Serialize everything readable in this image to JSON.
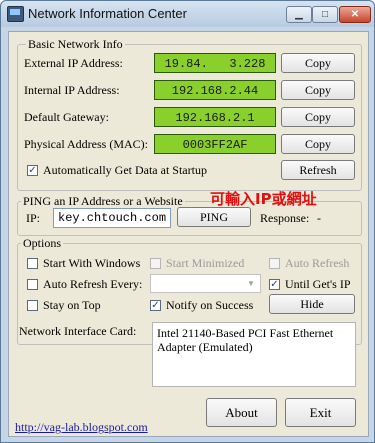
{
  "window": {
    "title": "Network Information Center",
    "min_glyph": "▁",
    "max_glyph": "□",
    "close_glyph": "✕"
  },
  "basic": {
    "legend": "Basic Network Info",
    "rows": [
      {
        "label": "External IP Address:",
        "value": "19.84.   3.228",
        "copy": "Copy"
      },
      {
        "label": "Internal IP Address:",
        "value": "192.168.2.44",
        "copy": "Copy"
      },
      {
        "label": "Default Gateway:",
        "value": "192.168.2.1",
        "copy": "Copy"
      },
      {
        "label": "Physical Address (MAC):",
        "value": "0003FF2AF",
        "copy": "Copy"
      }
    ],
    "auto_get_label": "Automatically Get Data at Startup",
    "auto_get_checked": true,
    "refresh": "Refresh"
  },
  "ping": {
    "legend": "PING an IP Address or a Website",
    "annotation": "可輸入IP或網址",
    "ip_label": "IP:",
    "ip_value": "key.chtouch.com",
    "button": "PING",
    "response_label": "Response:",
    "response_value": "-"
  },
  "options": {
    "legend": "Options",
    "start_with_windows": {
      "label": "Start With Windows",
      "checked": false
    },
    "start_minimized": {
      "label": "Start Minimized",
      "checked": false,
      "enabled": false
    },
    "auto_refresh": {
      "label": "Auto Refresh",
      "checked": false,
      "enabled": false
    },
    "auto_refresh_every": {
      "label": "Auto Refresh Every:",
      "checked": false,
      "value": ""
    },
    "until_gets_ip": {
      "label": "Until Get's IP",
      "checked": true
    },
    "stay_on_top": {
      "label": "Stay on Top",
      "checked": false
    },
    "notify_on_success": {
      "label": "Notify on Success",
      "checked": true
    },
    "hide": "Hide"
  },
  "nic": {
    "label": "Network Interface Card:",
    "value": "Intel 21140-Based PCI Fast Ethernet Adapter (Emulated)"
  },
  "footer": {
    "link": "http://vag-lab.blogspot.com",
    "about": "About",
    "exit": "Exit"
  },
  "colors": {
    "field_green": "#8ad02c",
    "annotation_red": "#e01010",
    "link_blue": "#1a1aa8"
  }
}
